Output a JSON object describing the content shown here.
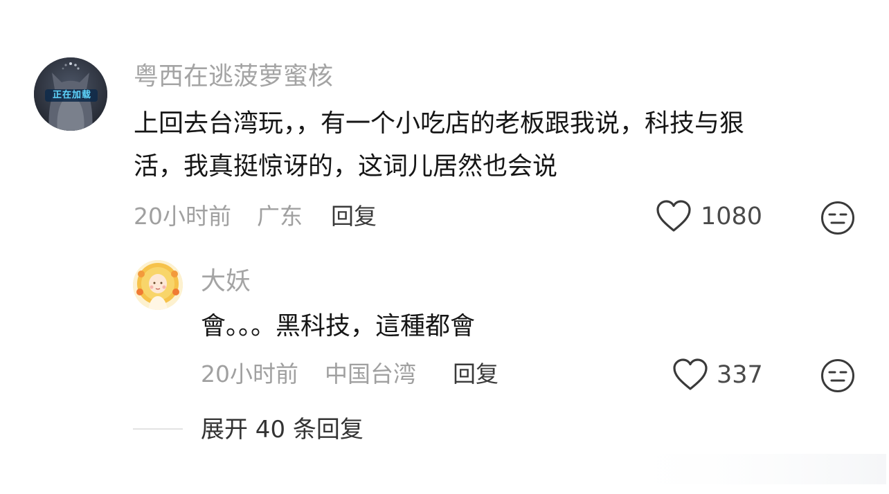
{
  "main_comment": {
    "username": "粤西在逃菠萝蜜核",
    "avatar_text": "正在加载",
    "text_line1": "上回去台湾玩，，有一个小吃店的老板跟我说，科技与狠",
    "text_line2": "活，我真挺惊讶的，这词儿居然也会说",
    "time": "20小时前",
    "location": "广东",
    "reply_label": "回复",
    "likes": "1080",
    "like_icon": "heart-outline-icon",
    "dislike_icon": "meh-face-icon"
  },
  "reply_comment": {
    "username": "大妖",
    "text": "會。。。黑科技，這種都會",
    "time": "20小时前",
    "location": "中国台湾",
    "reply_label": "回复",
    "likes": "337",
    "like_icon": "heart-outline-icon",
    "dislike_icon": "meh-face-icon"
  },
  "expand": {
    "label": "展开 40 条回复"
  },
  "colors": {
    "username": "#a4a4a4",
    "meta": "#a0a0a0",
    "text": "#161616",
    "icon": "#3a3a3a"
  }
}
